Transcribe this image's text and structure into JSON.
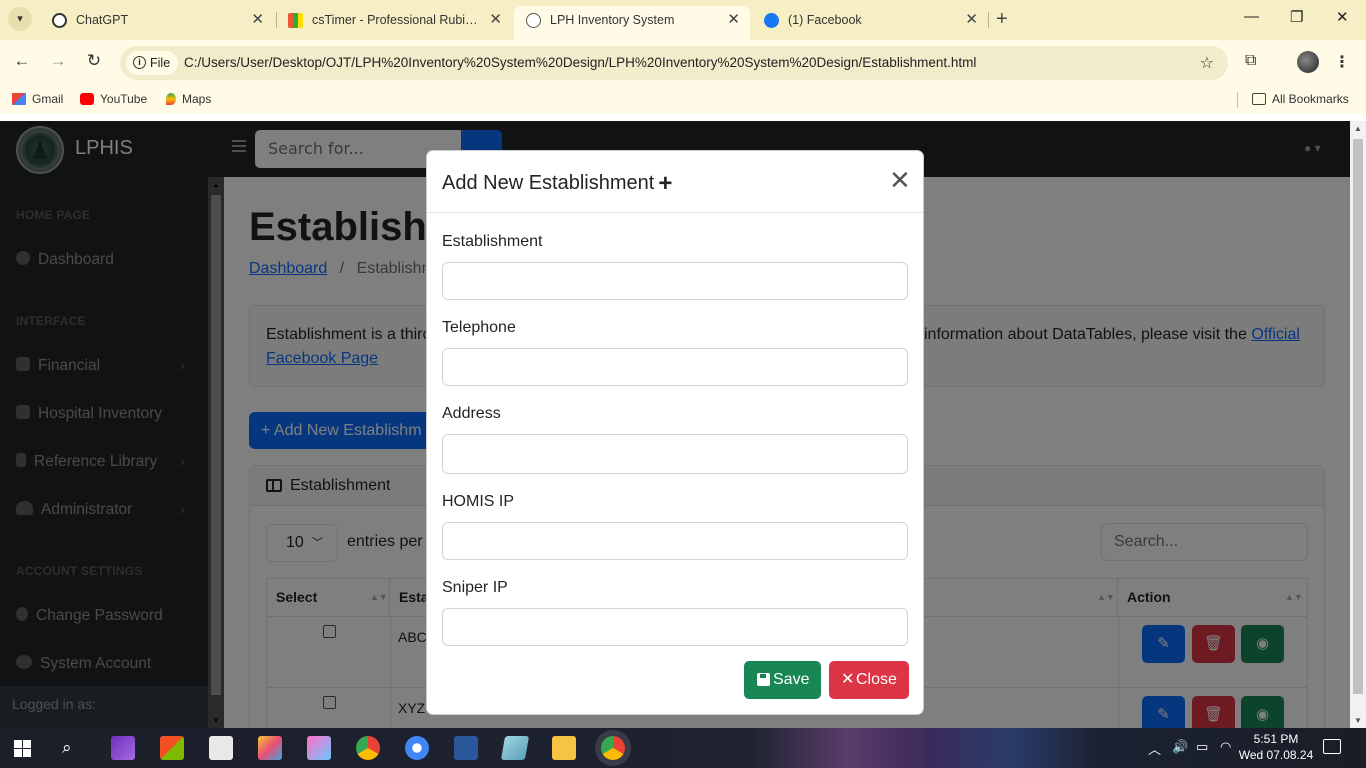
{
  "browser": {
    "tabs": [
      {
        "title": "ChatGPT",
        "active": false,
        "icon": "chatgpt-icon"
      },
      {
        "title": "csTimer - Professional Rubik's C",
        "active": false,
        "icon": "cstimer-icon"
      },
      {
        "title": "LPH Inventory System",
        "active": true,
        "icon": "globe-icon"
      },
      {
        "title": "(1) Facebook",
        "active": false,
        "icon": "facebook-icon"
      }
    ],
    "address_scheme": "File",
    "url": "C:/Users/User/Desktop/OJT/LPH%20Inventory%20System%20Design/LPH%20Inventory%20System%20Design/Establishment.html",
    "bookmarks": [
      "Gmail",
      "YouTube",
      "Maps"
    ],
    "all_bookmarks": "All Bookmarks"
  },
  "topnav": {
    "brand": "LPHIS",
    "search_placeholder": "Search for..."
  },
  "sidebar": {
    "headings": [
      "HOME PAGE",
      "INTERFACE",
      "ACCOUNT SETTINGS"
    ],
    "items": [
      {
        "label": "Dashboard",
        "icon": "gauge-icon"
      },
      {
        "label": "Financial",
        "icon": "money-icon"
      },
      {
        "label": "Hospital Inventory",
        "icon": "hospital-icon"
      },
      {
        "label": "Reference Library",
        "icon": "book-icon"
      },
      {
        "label": "Administrator",
        "icon": "users-cog-icon"
      },
      {
        "label": "Change Password",
        "icon": "key-icon"
      },
      {
        "label": "System Account",
        "icon": "user-gear-icon"
      }
    ],
    "footer": "Logged in as:"
  },
  "page": {
    "title": "Establishm",
    "breadcrumb": {
      "link": "Dashboard",
      "current": "Establishm"
    },
    "callout": {
      "left": "Establishment is a thirc",
      "right": "information about DataTables, please visit the",
      "link1": "Official",
      "link2": "Facebook Page"
    },
    "add_button": "+ Add New Establishm",
    "card_title": "Establishment",
    "entries_value": "10",
    "entries_label": "entries per",
    "search_placeholder": "Search...",
    "columns": [
      "Select",
      "Esta",
      "Action"
    ],
    "rows": [
      {
        "name": "ABC"
      },
      {
        "name": "XYZ"
      }
    ]
  },
  "modal": {
    "title": "Add New Establishment",
    "fields": [
      {
        "label": "Establishment",
        "value": ""
      },
      {
        "label": "Telephone",
        "value": ""
      },
      {
        "label": "Address",
        "value": ""
      },
      {
        "label": "HOMIS IP",
        "value": ""
      },
      {
        "label": "Sniper IP",
        "value": ""
      }
    ],
    "save_label": "Save",
    "close_label": "Close"
  },
  "taskbar": {
    "time": "5:51 PM",
    "date": "Wed 07.08.24"
  },
  "colors": {
    "primary": "#0d6efd",
    "success": "#198754",
    "danger": "#dc3545",
    "sidebar_bg": "#212529"
  }
}
